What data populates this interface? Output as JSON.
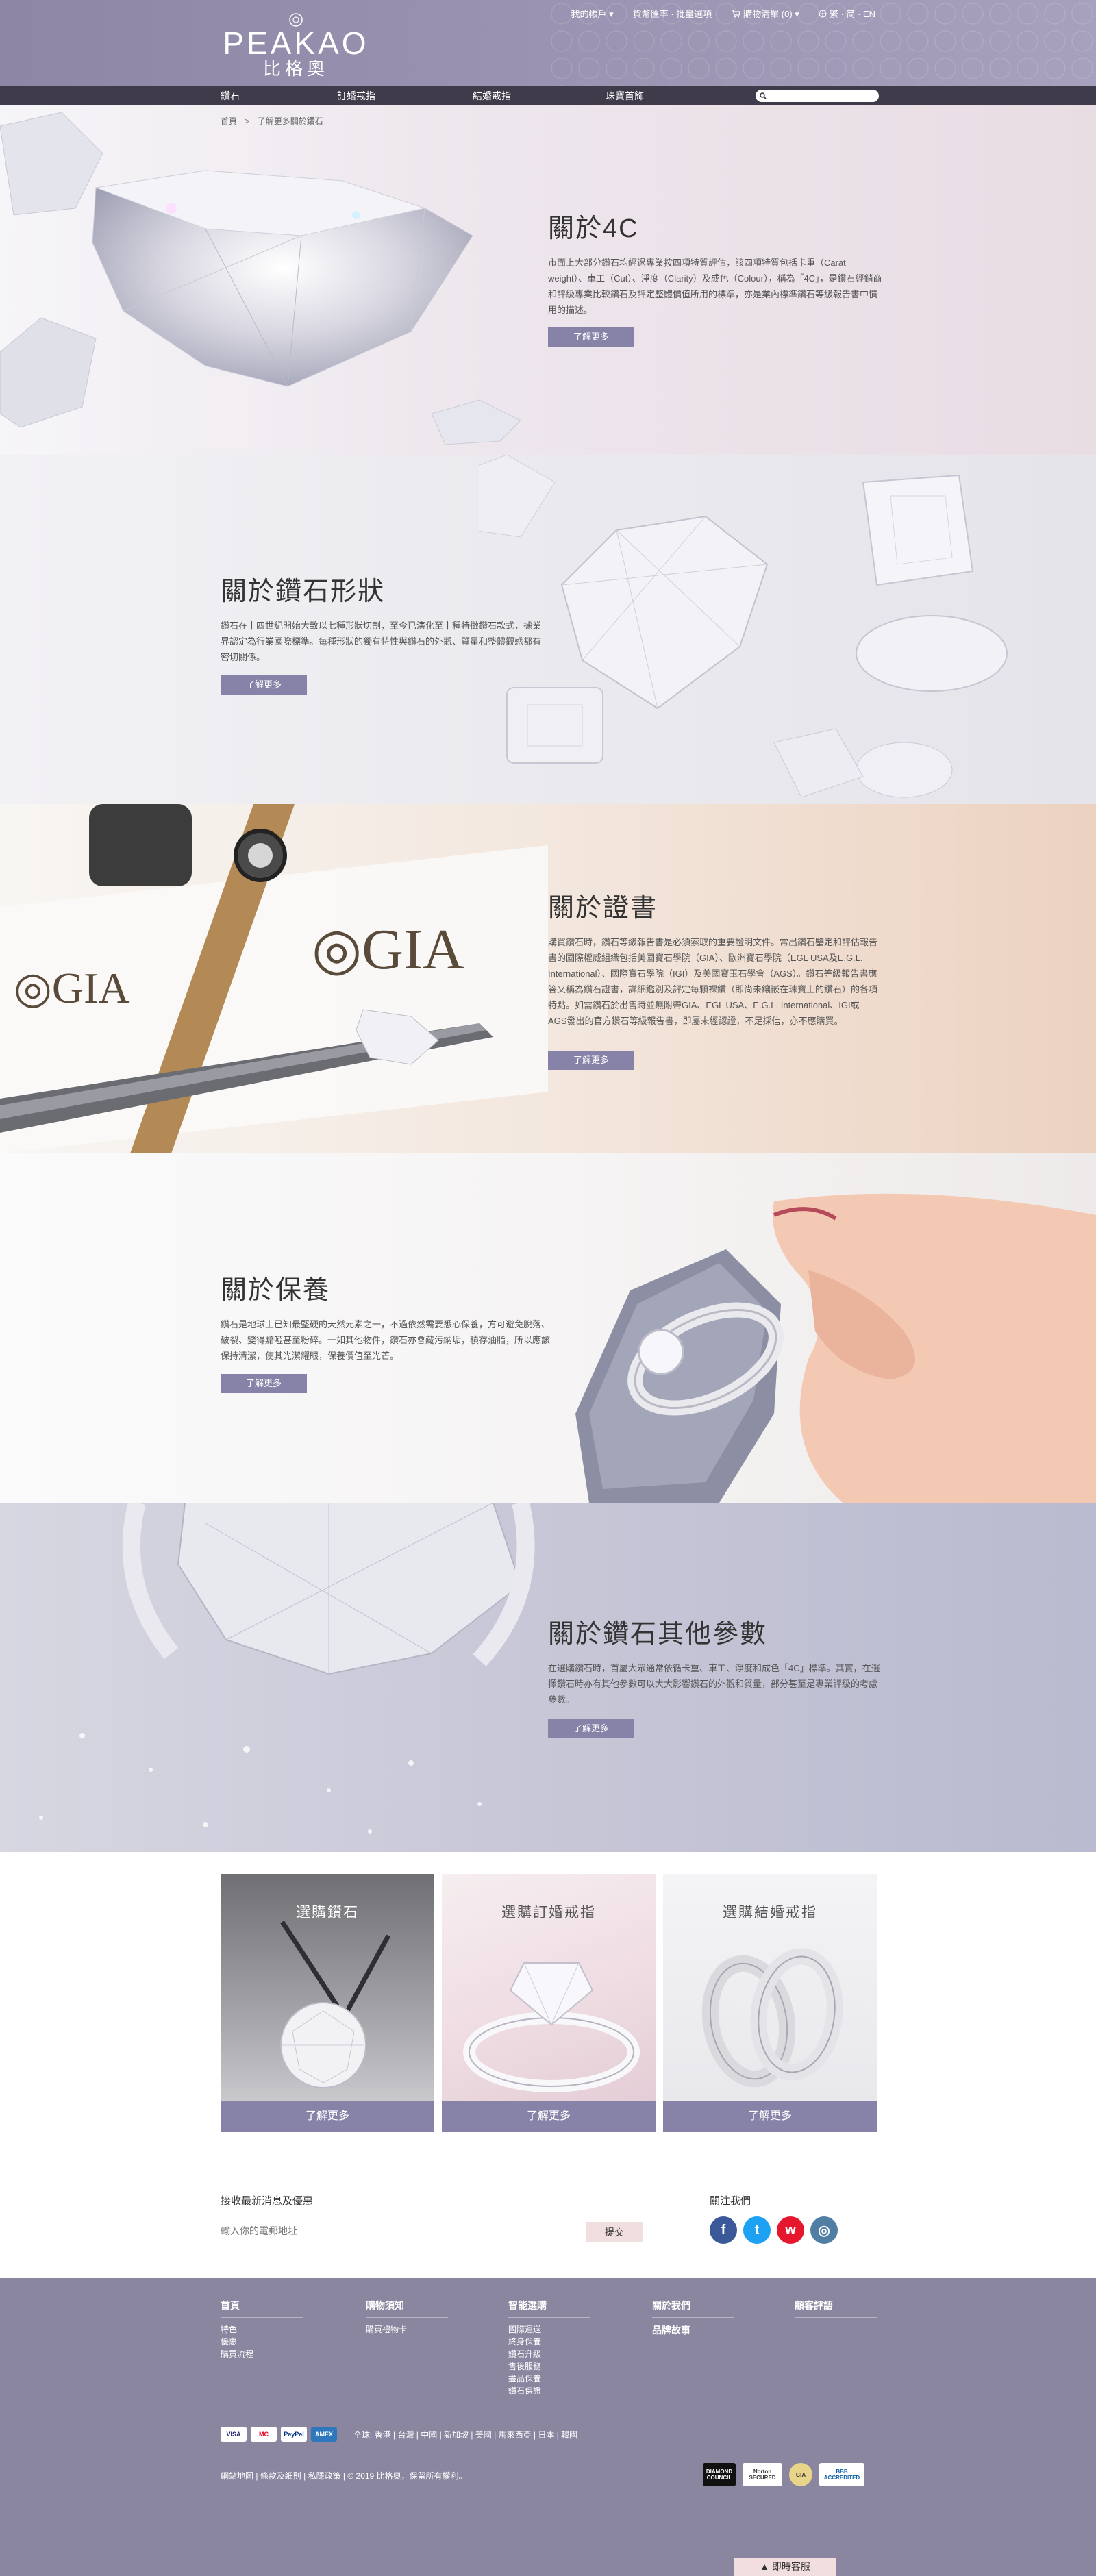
{
  "header": {
    "logo_en": "PEAKAO",
    "logo_zh": "比格奧",
    "top_links": [
      {
        "label": "我的帳戶 ▾"
      },
      {
        "label": "貨幣匯率 · 批量選項"
      },
      {
        "label": "購物清單 (0) ▾"
      },
      {
        "label": "繁 · 简 · EN"
      }
    ],
    "nav": [
      "鑽石",
      "訂婚戒指",
      "結婚戒指",
      "珠寶首飾"
    ],
    "search_placeholder": ""
  },
  "breadcrumb": [
    "首頁",
    ">",
    "了解更多關於鑽石"
  ],
  "sections": [
    {
      "title": "關於4C",
      "text": "市面上大部分鑽石均經過專業按四項特質評估，該四項特質包括卡重（Carat weight）、車工（Cut）、淨度（Clarity）及成色（Colour），稱為「4C」，是鑽石經銷商和評級專業比較鑽石及評定整體價值所用的標準，亦是業內標準鑽石等級報告書中慣用的描述。",
      "button": "了解更多"
    },
    {
      "title": "關於鑽石形狀",
      "text": "鑽石在十四世紀開始大致以七種形狀切割，至今已演化至十種特徵鑽石款式，據業界認定為行業國際標準。每種形狀的獨有特性與鑽石的外觀、質量和整體觀感都有密切關係。",
      "button": "了解更多"
    },
    {
      "title": "關於證書",
      "text": "購買鑽石時，鑽石等級報告書是必須索取的重要證明文件。常出鑽石鑒定和評估報告書的國際權威組織包括美國寶石學院（GIA）、歐洲寶石學院（EGL USA及E.G.L. International）、國際寶石學院（IGI）及美國寶玉石學會（AGS）。鑽石等級報告書應答又稱為鑽石證書，詳細鑑別及評定每顆裸鑽（即尚未鑲嵌在珠寶上的鑽石）的各項特點。如需鑽石於出售時並無附帶GIA、EGL USA、E.G.L. International、IGI或AGS發出的官方鑽石等級報告書，即屬未經認證，不足採信，亦不應購買。",
      "button": "了解更多"
    },
    {
      "title": "關於保養",
      "text": "鑽石是地球上已知最堅硬的天然元素之一，不過依然需要悉心保養，方可避免脫落、破裂、變得黯啞甚至粉碎。一如其他物件，鑽石亦會藏污納垢，積存油脂，所以應該保持清潔，使其光潔耀眼，保養價值至光芒。",
      "button": "了解更多"
    },
    {
      "title": "關於鑽石其他參數",
      "text": "在選購鑽石時，首屬大眾通常依循卡重、車工、淨度和成色「4C」標準。其實，在選擇鑽石時亦有其他參數可以大大影響鑽石的外觀和質量，部分甚至是專業評級的考慮參數。",
      "button": "了解更多"
    }
  ],
  "cards": [
    {
      "title": "選購鑽石",
      "button": "了解更多"
    },
    {
      "title": "選購訂婚戒指",
      "button": "了解更多"
    },
    {
      "title": "選購結婚戒指",
      "button": "了解更多"
    }
  ],
  "newsletter": {
    "label": "接收最新消息及優惠",
    "placeholder": "輸入你的電郵地址",
    "button": "提交",
    "follow_label": "關注我們"
  },
  "socials": [
    {
      "name": "facebook",
      "glyph": "f",
      "color": "#3b5998"
    },
    {
      "name": "twitter",
      "glyph": "t",
      "color": "#1da1f2"
    },
    {
      "name": "weibo",
      "glyph": "w",
      "color": "#e6162d"
    },
    {
      "name": "instagram",
      "glyph": "◎",
      "color": "#517fa4"
    }
  ],
  "footer": {
    "columns": [
      {
        "head": "首頁",
        "items": [
          "特色",
          "優惠",
          "購買流程"
        ]
      },
      {
        "head": "購物須知",
        "items": [
          "購買禮物卡"
        ]
      },
      {
        "head": "智能選購",
        "items": [
          "國際運送",
          "終身保養",
          "鑽石升級",
          "售後服務",
          "盡品保養",
          "鑽石保證"
        ]
      },
      {
        "head": "關於我們",
        "items": []
      },
      {
        "head": "顧客評語",
        "items": []
      }
    ],
    "column_extra": {
      "about_sub": "品牌故事"
    },
    "payments": [
      "VISA",
      "MC",
      "PayPal",
      "AMEX"
    ],
    "regions": "全球: 香港 | 台灣 | 中國 | 新加坡 | 美國 | 馬來西亞 | 日本 | 韓國",
    "copyright": "網站地圖 | 條款及細則 | 私隱政策 | © 2019 比格奧，保留所有權利。",
    "badges": [
      "DIAMOND COUNCIL",
      "Norton SECURED",
      "GIA",
      "BBB ACCREDITED"
    ],
    "customer_service": "▲ 即時客服"
  }
}
